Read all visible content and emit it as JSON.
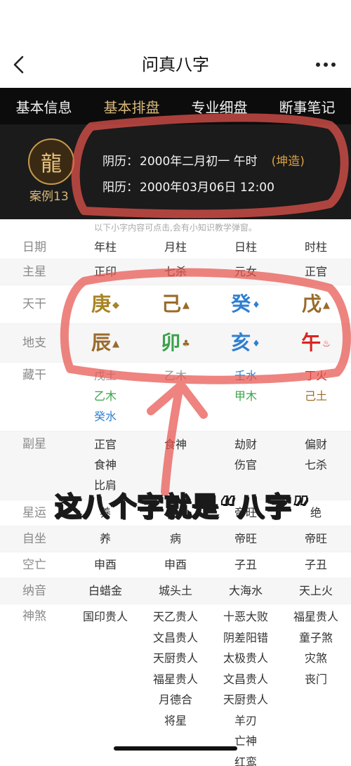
{
  "nav": {
    "title": "问真八字",
    "back_icon": "chevron-left-icon",
    "more_icon": "more-horizontal-icon"
  },
  "tabs": [
    {
      "label": "基本信息",
      "active": false
    },
    {
      "label": "基本排盘",
      "active": true
    },
    {
      "label": "专业细盘",
      "active": false
    },
    {
      "label": "断事笔记",
      "active": false
    }
  ],
  "case": {
    "label": "案例13",
    "lunar_label": "阴历：",
    "lunar_value": "2000年二月初一 午时",
    "gender": "(坤造)",
    "solar_label": "阳历：",
    "solar_value": "2000年03月06日 12:00"
  },
  "tip": "以下小字内容可点击,会有小知识教学弹窗。",
  "grid": {
    "header": {
      "label": "日期",
      "cols": [
        "年柱",
        "月柱",
        "日柱",
        "时柱"
      ]
    },
    "main_star": {
      "label": "主星",
      "cols": [
        "正印",
        "七杀",
        "元女",
        "正官"
      ]
    },
    "tiangan": {
      "label": "天干",
      "chars": [
        "庚",
        "己",
        "癸",
        "戊"
      ],
      "icons": [
        "metal-icon",
        "earth-icon",
        "water-icon",
        "earth-icon"
      ]
    },
    "dizhi": {
      "label": "地支",
      "chars": [
        "辰",
        "卯",
        "亥",
        "午"
      ],
      "icons": [
        "earth-icon",
        "wood-icon",
        "water-icon",
        "fire-icon"
      ]
    },
    "canggan": {
      "label": "藏干",
      "cols": [
        [
          "戊土",
          "乙木",
          "癸水"
        ],
        [
          "乙木"
        ],
        [
          "壬水",
          "甲木"
        ],
        [
          "丁火",
          "己土"
        ]
      ]
    },
    "fuxing": {
      "label": "副星",
      "cols": [
        [
          "正官",
          "食神",
          "比肩"
        ],
        [
          "食神"
        ],
        [
          "劫财",
          "伤官"
        ],
        [
          "偏财",
          "七杀"
        ]
      ]
    },
    "xingyun": {
      "label": "星运",
      "cols": [
        "养",
        "",
        "帝旺",
        "绝"
      ]
    },
    "zizuo": {
      "label": "自坐",
      "cols": [
        "养",
        "病",
        "帝旺",
        "帝旺"
      ]
    },
    "kongwang": {
      "label": "空亡",
      "cols": [
        "申酉",
        "申酉",
        "子丑",
        "子丑"
      ]
    },
    "nayin": {
      "label": "纳音",
      "cols": [
        "白蜡金",
        "城头土",
        "大海水",
        "天上火"
      ]
    },
    "shensha": {
      "label": "神煞",
      "cols": [
        [
          "国印贵人"
        ],
        [
          "天乙贵人",
          "文昌贵人",
          "天厨贵人",
          "福星贵人",
          "月德合",
          "将星"
        ],
        [
          "十恶大败",
          "阴差阳错",
          "太极贵人",
          "文昌贵人",
          "天厨贵人",
          "羊刃",
          "亡神",
          "红鸾"
        ],
        [
          "福星贵人",
          "童子煞",
          "灾煞",
          "丧门"
        ]
      ]
    }
  },
  "overlay": {
    "caption": "这八个字就是“八字”",
    "annotation_color": "#e8544e"
  }
}
